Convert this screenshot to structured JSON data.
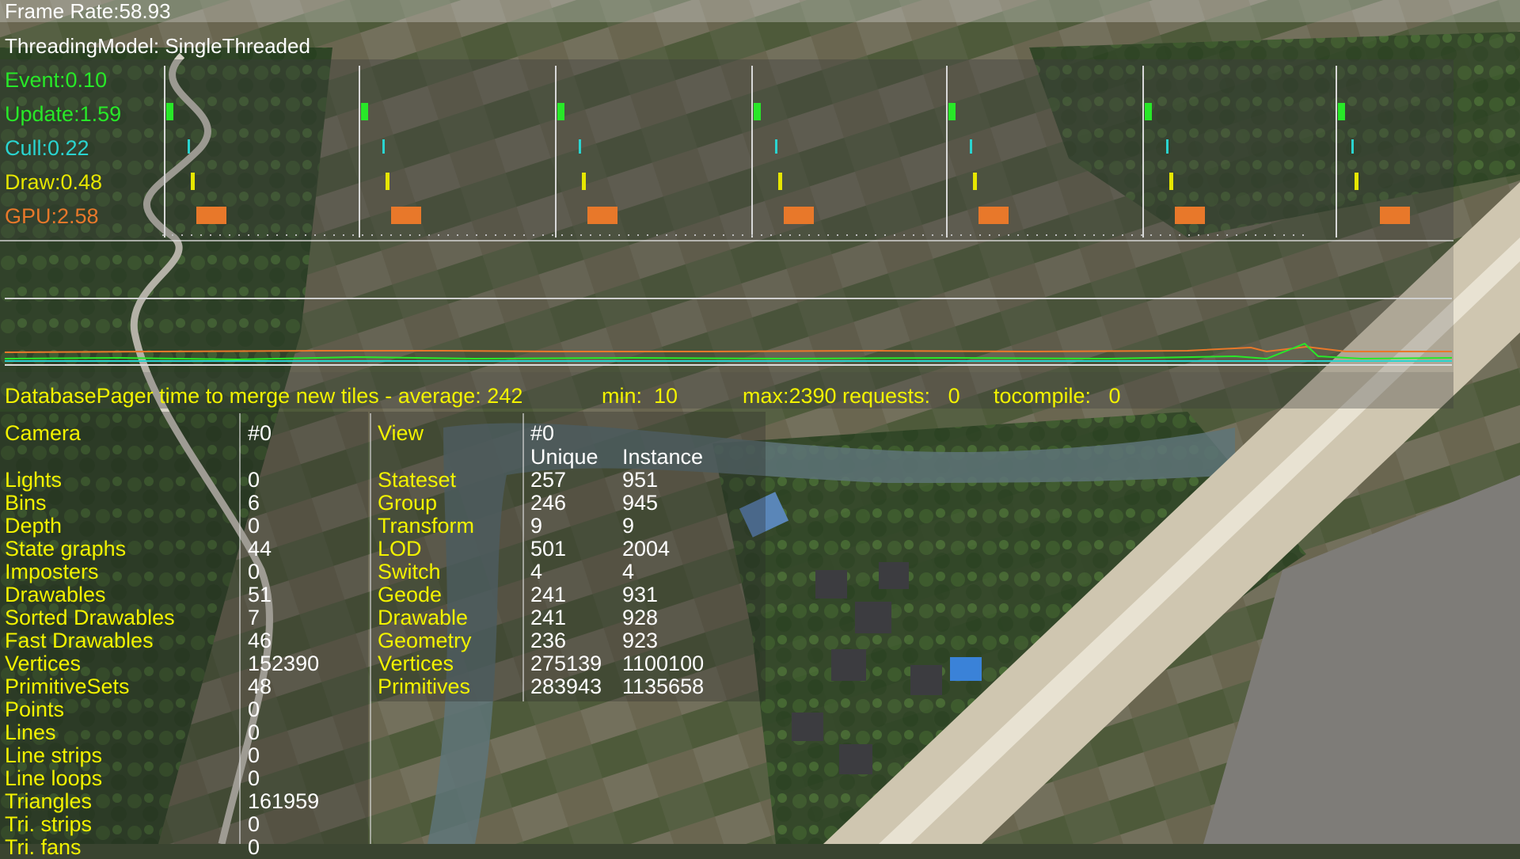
{
  "header": {
    "frame_rate": "Frame Rate:58.93",
    "threading_model": "ThreadingModel: SingleThreaded"
  },
  "timing": [
    {
      "label": "Event:0.10",
      "color": "#28e828"
    },
    {
      "label": "Update:1.59",
      "color": "#28e828"
    },
    {
      "label": "Cull:0.22",
      "color": "#2ad4d0"
    },
    {
      "label": "Draw:0.48",
      "color": "#e6e600"
    },
    {
      "label": "GPU:2.58",
      "color": "#e8782a"
    }
  ],
  "pager": {
    "average": "DatabasePager time to merge new tiles - average: 242",
    "min": "min:  10",
    "max": "max:2390",
    "requests": "requests:   0",
    "tocompile": "tocompile:   0"
  },
  "camera": {
    "title": "Camera",
    "id": "#0",
    "labels": [
      "Lights",
      "Bins",
      "Depth",
      "State graphs",
      "Imposters",
      "Drawables",
      "Sorted Drawables",
      "Fast Drawables",
      "Vertices",
      "PrimitiveSets",
      "Points",
      "Lines",
      "Line strips",
      "Line loops",
      "Triangles",
      "Tri. strips",
      "Tri. fans"
    ],
    "values": [
      "0",
      "6",
      "0",
      "44",
      "0",
      "51",
      "7",
      "46",
      "152390",
      "48",
      "0",
      "0",
      "0",
      "0",
      "161959",
      "0",
      "0"
    ]
  },
  "view": {
    "title": "View",
    "id": "#0",
    "header_unique": "Unique",
    "header_instance": "Instance",
    "labels": [
      "Stateset",
      "Group",
      "Transform",
      "LOD",
      "Switch",
      "Geode",
      "Drawable",
      "Geometry",
      "Vertices",
      "Primitives"
    ],
    "unique": [
      "257",
      "246",
      "9",
      "501",
      "4",
      "241",
      "241",
      "236",
      "275139",
      "283943"
    ],
    "instance": [
      "951",
      "945",
      "9",
      "2004",
      "4",
      "931",
      "928",
      "923",
      "1100100",
      "1135658"
    ]
  },
  "colors": {
    "stat_label": "#f2f200",
    "header_text": "#ffffff",
    "background": "#3a4430"
  }
}
